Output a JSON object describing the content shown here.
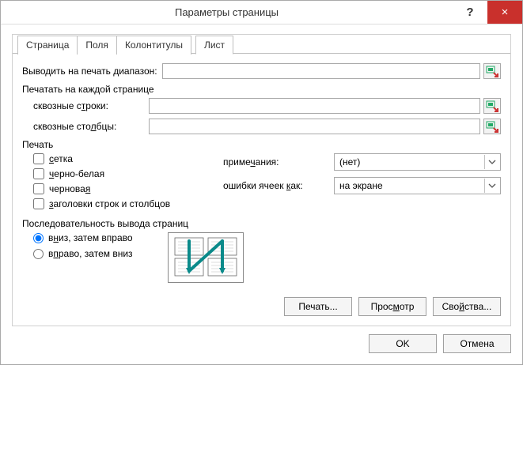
{
  "window": {
    "title": "Параметры страницы"
  },
  "tabs": {
    "page": "Страница",
    "fields": "Поля",
    "headers": "Колонтитулы",
    "sheet": "Лист",
    "active": "sheet"
  },
  "print_area": {
    "label": "Выводить на печать диапазон:",
    "value": ""
  },
  "repeat_group": {
    "legend": "Печатать на каждой странице",
    "rows_label": "сквозные строки:",
    "rows_value": "",
    "cols_label": "сквозные столбцы:",
    "cols_value": ""
  },
  "print_group": {
    "legend": "Печать",
    "grid": "сетка",
    "bw": "черно-белая",
    "draft": "черновая",
    "headings": "заголовки строк и столбцов",
    "comments_label": "примечания:",
    "comments_value": "(нет)",
    "errors_label": "ошибки ячеек как:",
    "errors_value": "на экране"
  },
  "order_group": {
    "legend": "Последовательность вывода страниц",
    "down_then_over": "вниз, затем вправо",
    "over_then_down": "вправо, затем вниз",
    "selected": "down"
  },
  "buttons": {
    "print": "Печать...",
    "preview": "Просмотр",
    "options": "Свойства...",
    "ok": "OK",
    "cancel": "Отмена"
  },
  "icons": {
    "help": "?",
    "close": "×"
  }
}
